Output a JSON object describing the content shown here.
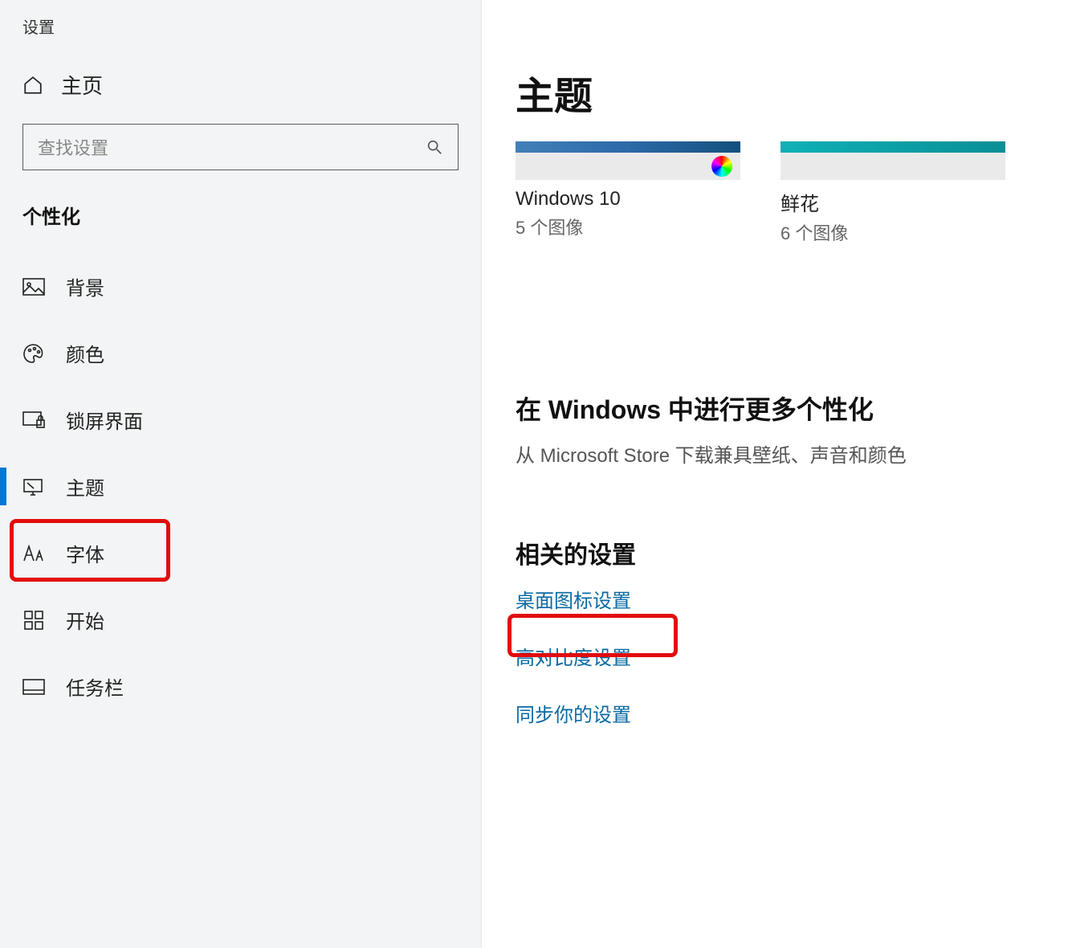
{
  "app_title": "设置",
  "home_label": "主页",
  "search_placeholder": "查找设置",
  "section_label": "个性化",
  "nav": {
    "background": "背景",
    "colors": "颜色",
    "lockscreen": "锁屏界面",
    "themes": "主题",
    "fonts": "字体",
    "start": "开始",
    "taskbar": "任务栏"
  },
  "main": {
    "page_title": "主题",
    "themes": [
      {
        "name": "Windows 10",
        "count": "5 个图像"
      },
      {
        "name": "鲜花",
        "count": "6 个图像"
      }
    ],
    "more_heading": "在 Windows 中进行更多个性化",
    "more_sub": "从 Microsoft Store 下载兼具壁纸、声音和颜色",
    "related_heading": "相关的设置",
    "related_links": {
      "desktop_icons": "桌面图标设置",
      "high_contrast": "高对比度设置",
      "sync": "同步你的设置"
    }
  }
}
